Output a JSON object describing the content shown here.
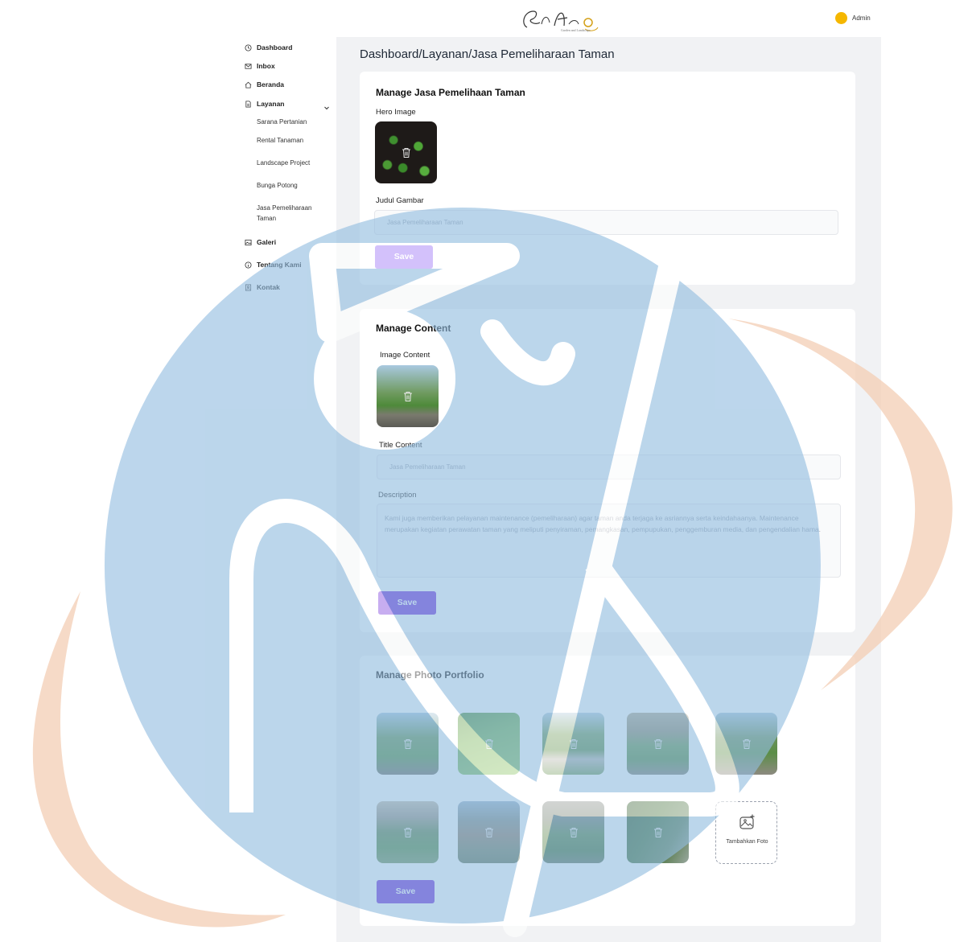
{
  "header": {
    "logo_text": "Sekar Asri",
    "user_name": "Admin",
    "avatar_color": "#f5b700"
  },
  "sidebar": {
    "items": [
      {
        "label": "Dashboard",
        "icon": "clock-icon"
      },
      {
        "label": "Inbox",
        "icon": "mail-icon"
      },
      {
        "label": "Beranda",
        "icon": "home-icon"
      },
      {
        "label": "Layanan",
        "icon": "document-icon"
      },
      {
        "label": "Galeri",
        "icon": "image-icon"
      },
      {
        "label": "Tentang Kami",
        "icon": "info-icon"
      },
      {
        "label": "Kontak",
        "icon": "contact-icon"
      }
    ],
    "sub_items": [
      {
        "label": "Sarana Pertanian"
      },
      {
        "label": "Rental Tanaman"
      },
      {
        "label": "Landscape Project"
      },
      {
        "label": "Bunga Potong"
      },
      {
        "label": "Jasa Pemeliharaan Taman"
      }
    ]
  },
  "main": {
    "breadcrumb": "Dashboard/Layanan/Jasa Pemeliharaan Taman",
    "hero": {
      "title": "Manage Jasa Pemelihaan Taman",
      "hero_image_label": "Hero Image",
      "judul_label": "Judul Gambar",
      "judul_placeholder": "Jasa Pemeliharaan Taman",
      "save_label": "Save"
    },
    "content": {
      "title": "Manage Content",
      "image_label": "Image Content",
      "title_label": "Title Content",
      "title_placeholder": "Jasa Pemeliharaan Taman",
      "description_label": "Description",
      "description_text": "Kami juga memberikan pelayanan maintenance (pemeliharaan) agar taman anda terjaga ke asriannya serta keindahaanya. Maintenance merupakan kegiatan perawatan taman yang meliputi penyiraman, pemangkasan, pempupukan, penggemburan media, dan pengendalian hama.",
      "save_label": "Save"
    },
    "portfolio": {
      "title": "Manage Photo Portfolio",
      "add_label": "Tambahkan Foto",
      "save_label": "Save"
    }
  },
  "colors": {
    "accent": "#8b5cf6",
    "accent_dark": "#6d28d9",
    "watermark_blue": "#b9d1e8",
    "watermark_orange": "#f3d3bd"
  }
}
